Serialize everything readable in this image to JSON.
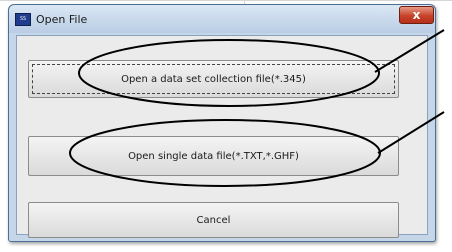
{
  "window": {
    "title": "Open File",
    "app_icon": "app-icon",
    "close_icon": "close-icon",
    "close_glyph": "x"
  },
  "buttons": {
    "open_collection": "Open a data set collection file(*.345)",
    "open_single": "Open single data file(*.TXT,*.GHF)",
    "cancel": "Cancel"
  },
  "colors": {
    "title_bar": "#c5d6e8",
    "close_button": "#c7432a",
    "client_background": "#ebebeb"
  }
}
